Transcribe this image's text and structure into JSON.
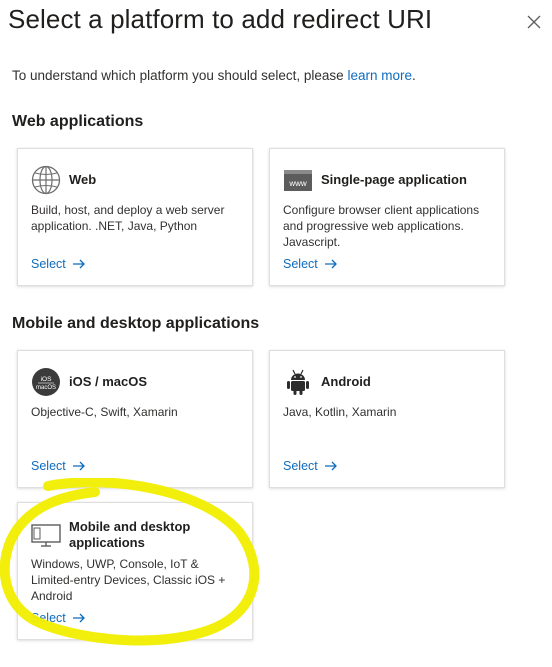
{
  "dialog": {
    "title": "Select a platform to add redirect URI",
    "intro_text": "To understand which platform you should select, please ",
    "intro_link": "learn more",
    "intro_end": "."
  },
  "sections": {
    "web": "Web applications",
    "mobile": "Mobile and desktop applications"
  },
  "cards": {
    "web": {
      "name": "Web",
      "description": "Build, host, and deploy a web server application. .NET, Java, Python",
      "select": "Select"
    },
    "spa": {
      "name": "Single-page application",
      "icon_text": "www",
      "description": "Configure browser client applications and progressive web applications. Javascript.",
      "select": "Select"
    },
    "ios": {
      "name": "iOS / macOS",
      "icon_text_1": "iOS",
      "icon_text_2": "macOS",
      "description": "Objective-C, Swift, Xamarin",
      "select": "Select"
    },
    "android": {
      "name": "Android",
      "description": "Java, Kotlin, Xamarin",
      "select": "Select"
    },
    "desktop": {
      "name": "Mobile and desktop applications",
      "description": "Windows, UWP, Console, IoT & Limited-entry Devices, Classic iOS + Android",
      "select": "Select"
    }
  },
  "colors": {
    "link": "#0f6cbd",
    "highlight": "#f2ee00"
  },
  "icons": [
    "close-icon",
    "globe-icon",
    "www-browser-icon",
    "ios-macos-icon",
    "android-icon",
    "desktop-monitor-icon",
    "arrow-right-icon"
  ]
}
